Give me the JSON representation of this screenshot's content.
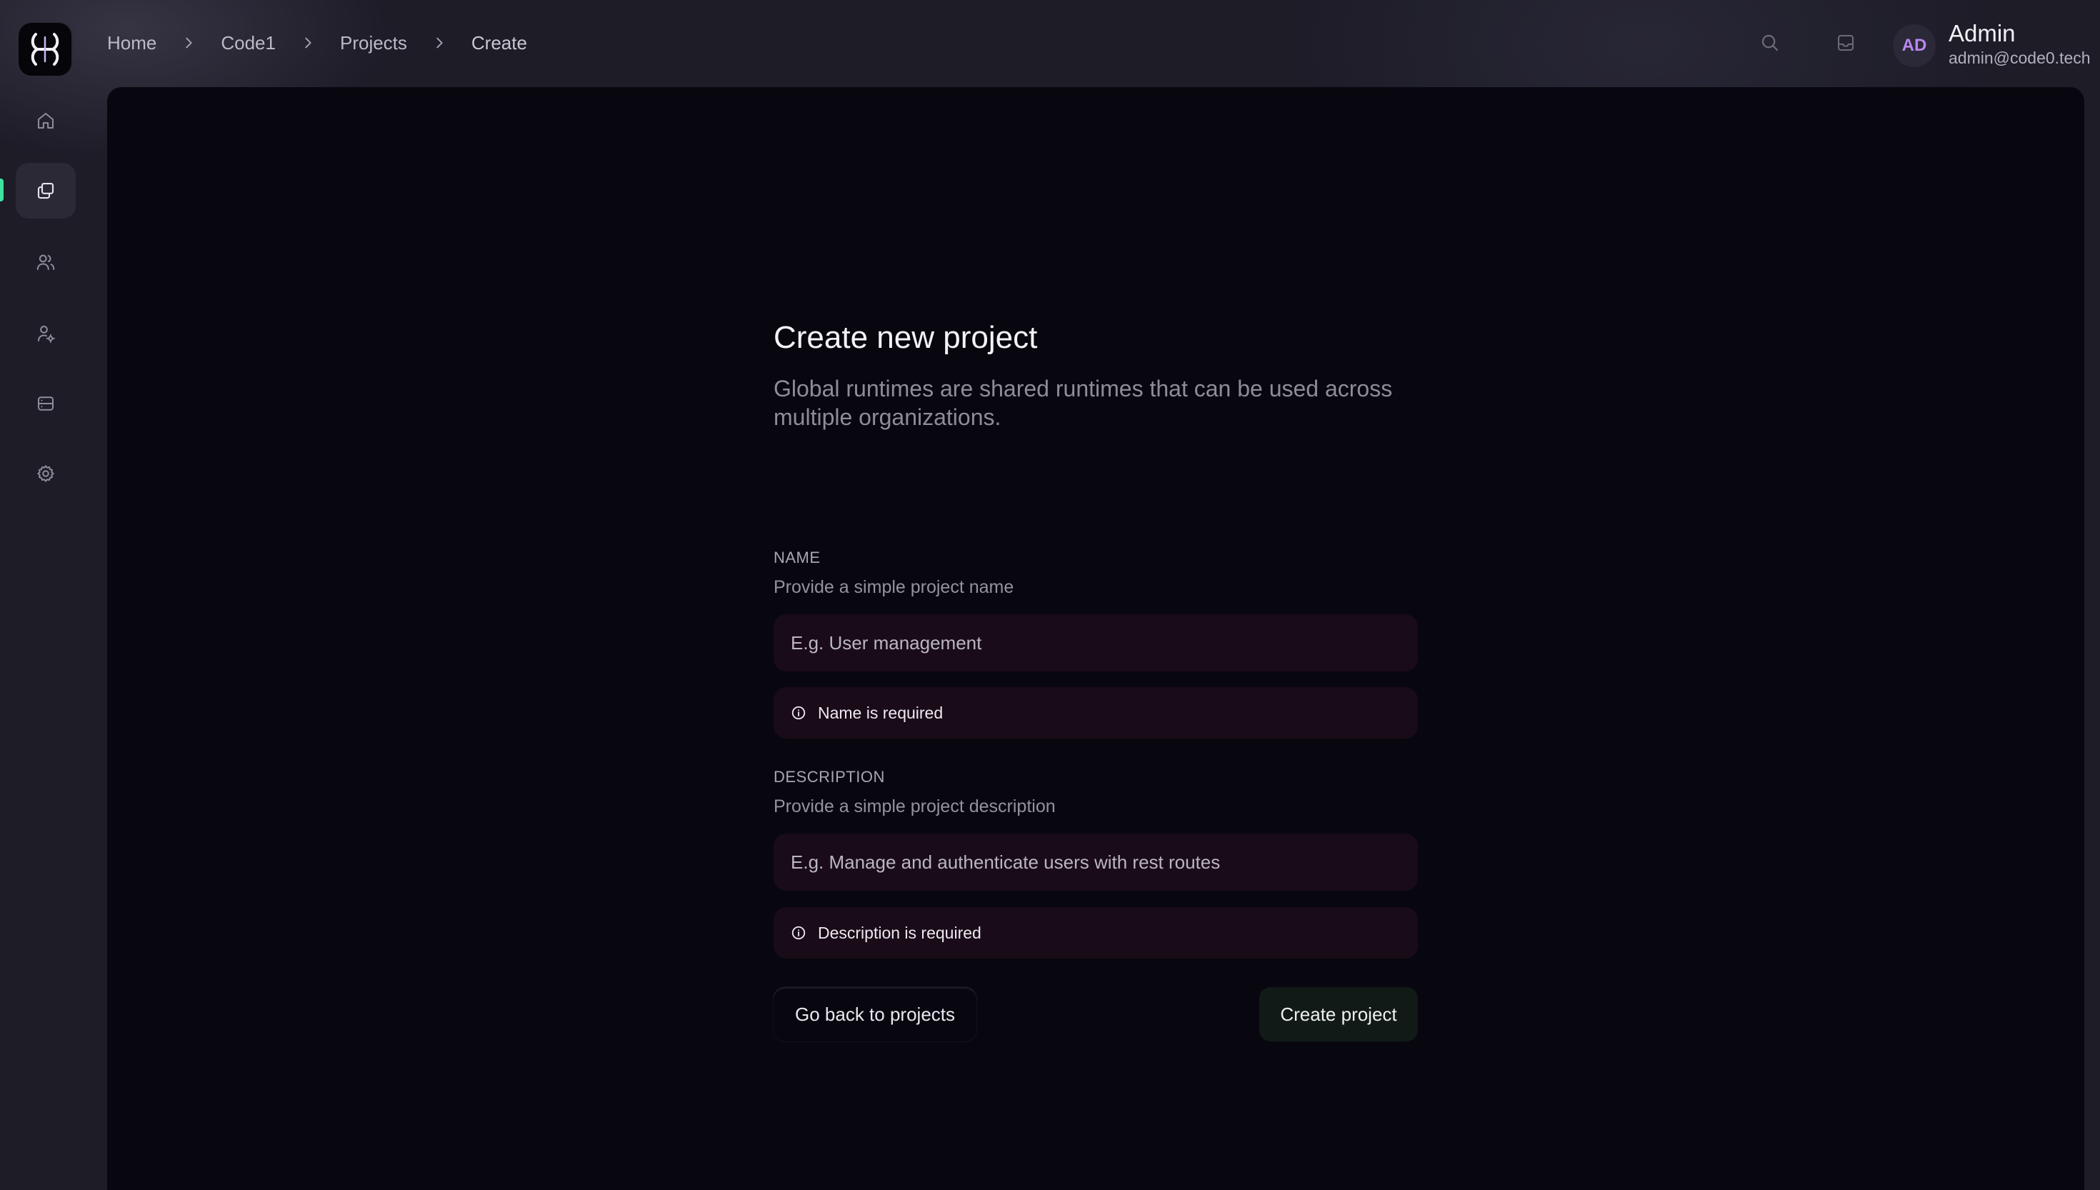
{
  "colors": {
    "accent": "#3fe3a0",
    "avatar_text": "#b887f0",
    "main_bg": "#08070f",
    "field_bg": "#1a0b19"
  },
  "sidebar": {
    "logo_icon": "code0-logo",
    "items": [
      {
        "icon": "home-icon",
        "active": false
      },
      {
        "icon": "projects-icon",
        "active": true
      },
      {
        "icon": "users-icon",
        "active": false
      },
      {
        "icon": "user-settings-icon",
        "active": false
      },
      {
        "icon": "server-icon",
        "active": false
      },
      {
        "icon": "settings-icon",
        "active": false
      }
    ]
  },
  "breadcrumb": {
    "items": [
      "Home",
      "Code1",
      "Projects",
      "Create"
    ]
  },
  "header": {
    "search_icon": "search-icon",
    "inbox_icon": "inbox-icon",
    "user": {
      "initials": "AD",
      "name": "Admin",
      "email": "admin@code0.tech"
    }
  },
  "form": {
    "title": "Create new project",
    "subtitle": "Global runtimes are shared runtimes that can be used across multiple organizations.",
    "name": {
      "label": "NAME",
      "hint": "Provide a simple project name",
      "placeholder": "E.g. User management",
      "value": "",
      "error": "Name is required"
    },
    "description": {
      "label": "DESCRIPTION",
      "hint": "Provide a simple project description",
      "placeholder": "E.g. Manage and authenticate users with rest routes",
      "value": "",
      "error": "Description is required"
    },
    "back_button": "Go back to projects",
    "create_button": "Create project"
  }
}
